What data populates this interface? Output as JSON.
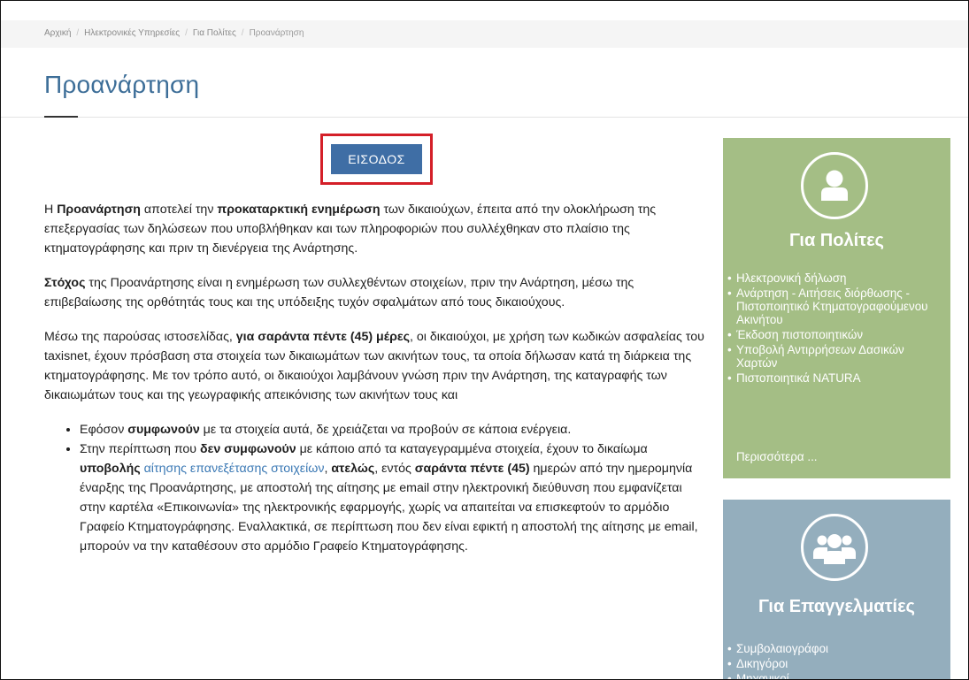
{
  "breadcrumb": [
    "Αρχική",
    "Ηλεκτρονικές Υπηρεσίες",
    "Για Πολίτες",
    "Προανάρτηση"
  ],
  "page": {
    "title": "Προανάρτηση"
  },
  "login": {
    "label": "ΕΙΣΟΔΟΣ"
  },
  "body": {
    "p1": [
      "Η ",
      "Προανάρτηση",
      " αποτελεί την ",
      "προκαταρκτική ενημέρωση",
      " των δικαιούχων, έπειτα από την ολοκλήρωση της επεξεργασίας των δηλώσεων που υποβλήθηκαν και των πληροφοριών που συλλέχθηκαν στο πλαίσιο της κτηματογράφησης και πριν τη διενέργεια της Ανάρτησης."
    ],
    "p2": [
      "Στόχος",
      " της Προανάρτησης είναι η ενημέρωση των συλλεχθέντων στοιχείων, πριν την Ανάρτηση, μέσω της επιβεβαίωσης της ορθότητάς τους και της υπόδειξης τυχόν σφαλμάτων από τους δικαιούχους."
    ],
    "p3": [
      "Μέσω της παρούσας ιστοσελίδας, ",
      "για σαράντα πέντε (45) μέρες",
      ", οι δικαιούχοι, με χρήση των κωδικών ασφαλείας του taxisnet, έχουν πρόσβαση στα στοιχεία των δικαιωμάτων των ακινήτων τους, τα οποία δήλωσαν κατά τη διάρκεια της κτηματογράφησης. Με τον τρόπο αυτό, οι δικαιούχοι λαμβάνουν γνώση πριν την Ανάρτηση, της καταγραφής των δικαιωμάτων τους και της γεωγραφικής απεικόνισης των ακινήτων τους και"
    ],
    "li1": [
      "Εφόσον ",
      "συμφωνούν",
      " με τα στοιχεία αυτά, δε χρειάζεται να προβούν σε κάποια ενέργεια."
    ],
    "li2": [
      "Στην περίπτωση που ",
      "δεν συμφωνούν",
      " με κάποιο από τα καταγεγραμμένα στοιχεία, έχουν το δικαίωμα ",
      "υποβολής",
      " ",
      "αίτησης επανεξέτασης στοιχείων",
      ", ",
      "ατελώς",
      ", εντός ",
      "σαράντα πέντε (45)",
      " ημερών από την ημερομηνία έναρξης της Προανάρτησης, με αποστολή της αίτησης με email στην ηλεκτρονική διεύθυνση που εμφανίζεται στην καρτέλα «Επικοινωνία» της ηλεκτρονικής εφαρμογής, χωρίς να απαιτείται να επισκεφτούν το αρμόδιο Γραφείο Κτηματογράφησης. Εναλλακτικά, σε περίπτωση που δεν είναι εφικτή η αποστολή της αίτησης με email, μπορούν να την καταθέσουν στο αρμόδιο Γραφείο Κτηματογράφησης."
    ]
  },
  "sidebar": {
    "citizens": {
      "title": "Για Πολίτες",
      "icon": "user-icon",
      "color": "#a4be85",
      "items": [
        "Ηλεκτρονική δήλωση",
        "Ανάρτηση - Αιτήσεις διόρθωσης - Πιστοποιητικό Κτηματογραφούμενου Ακινήτου",
        "Έκδοση πιστοποιητικών",
        "Υποβολή Αντιρρήσεων Δασικών Χαρτών",
        "Πιστοποιητικά NATURA"
      ],
      "more": "Περισσότερα ..."
    },
    "professionals": {
      "title": "Για Επαγγελματίες",
      "icon": "users-group-icon",
      "color": "#94aebd",
      "items": [
        "Συμβολαιογράφοι",
        "Δικηγόροι",
        "Μηχανικοί"
      ]
    }
  },
  "colors": {
    "title": "#3d6e98",
    "button": "#3f6ea5",
    "highlight_border": "#d41f28",
    "link": "#3a78b4"
  }
}
